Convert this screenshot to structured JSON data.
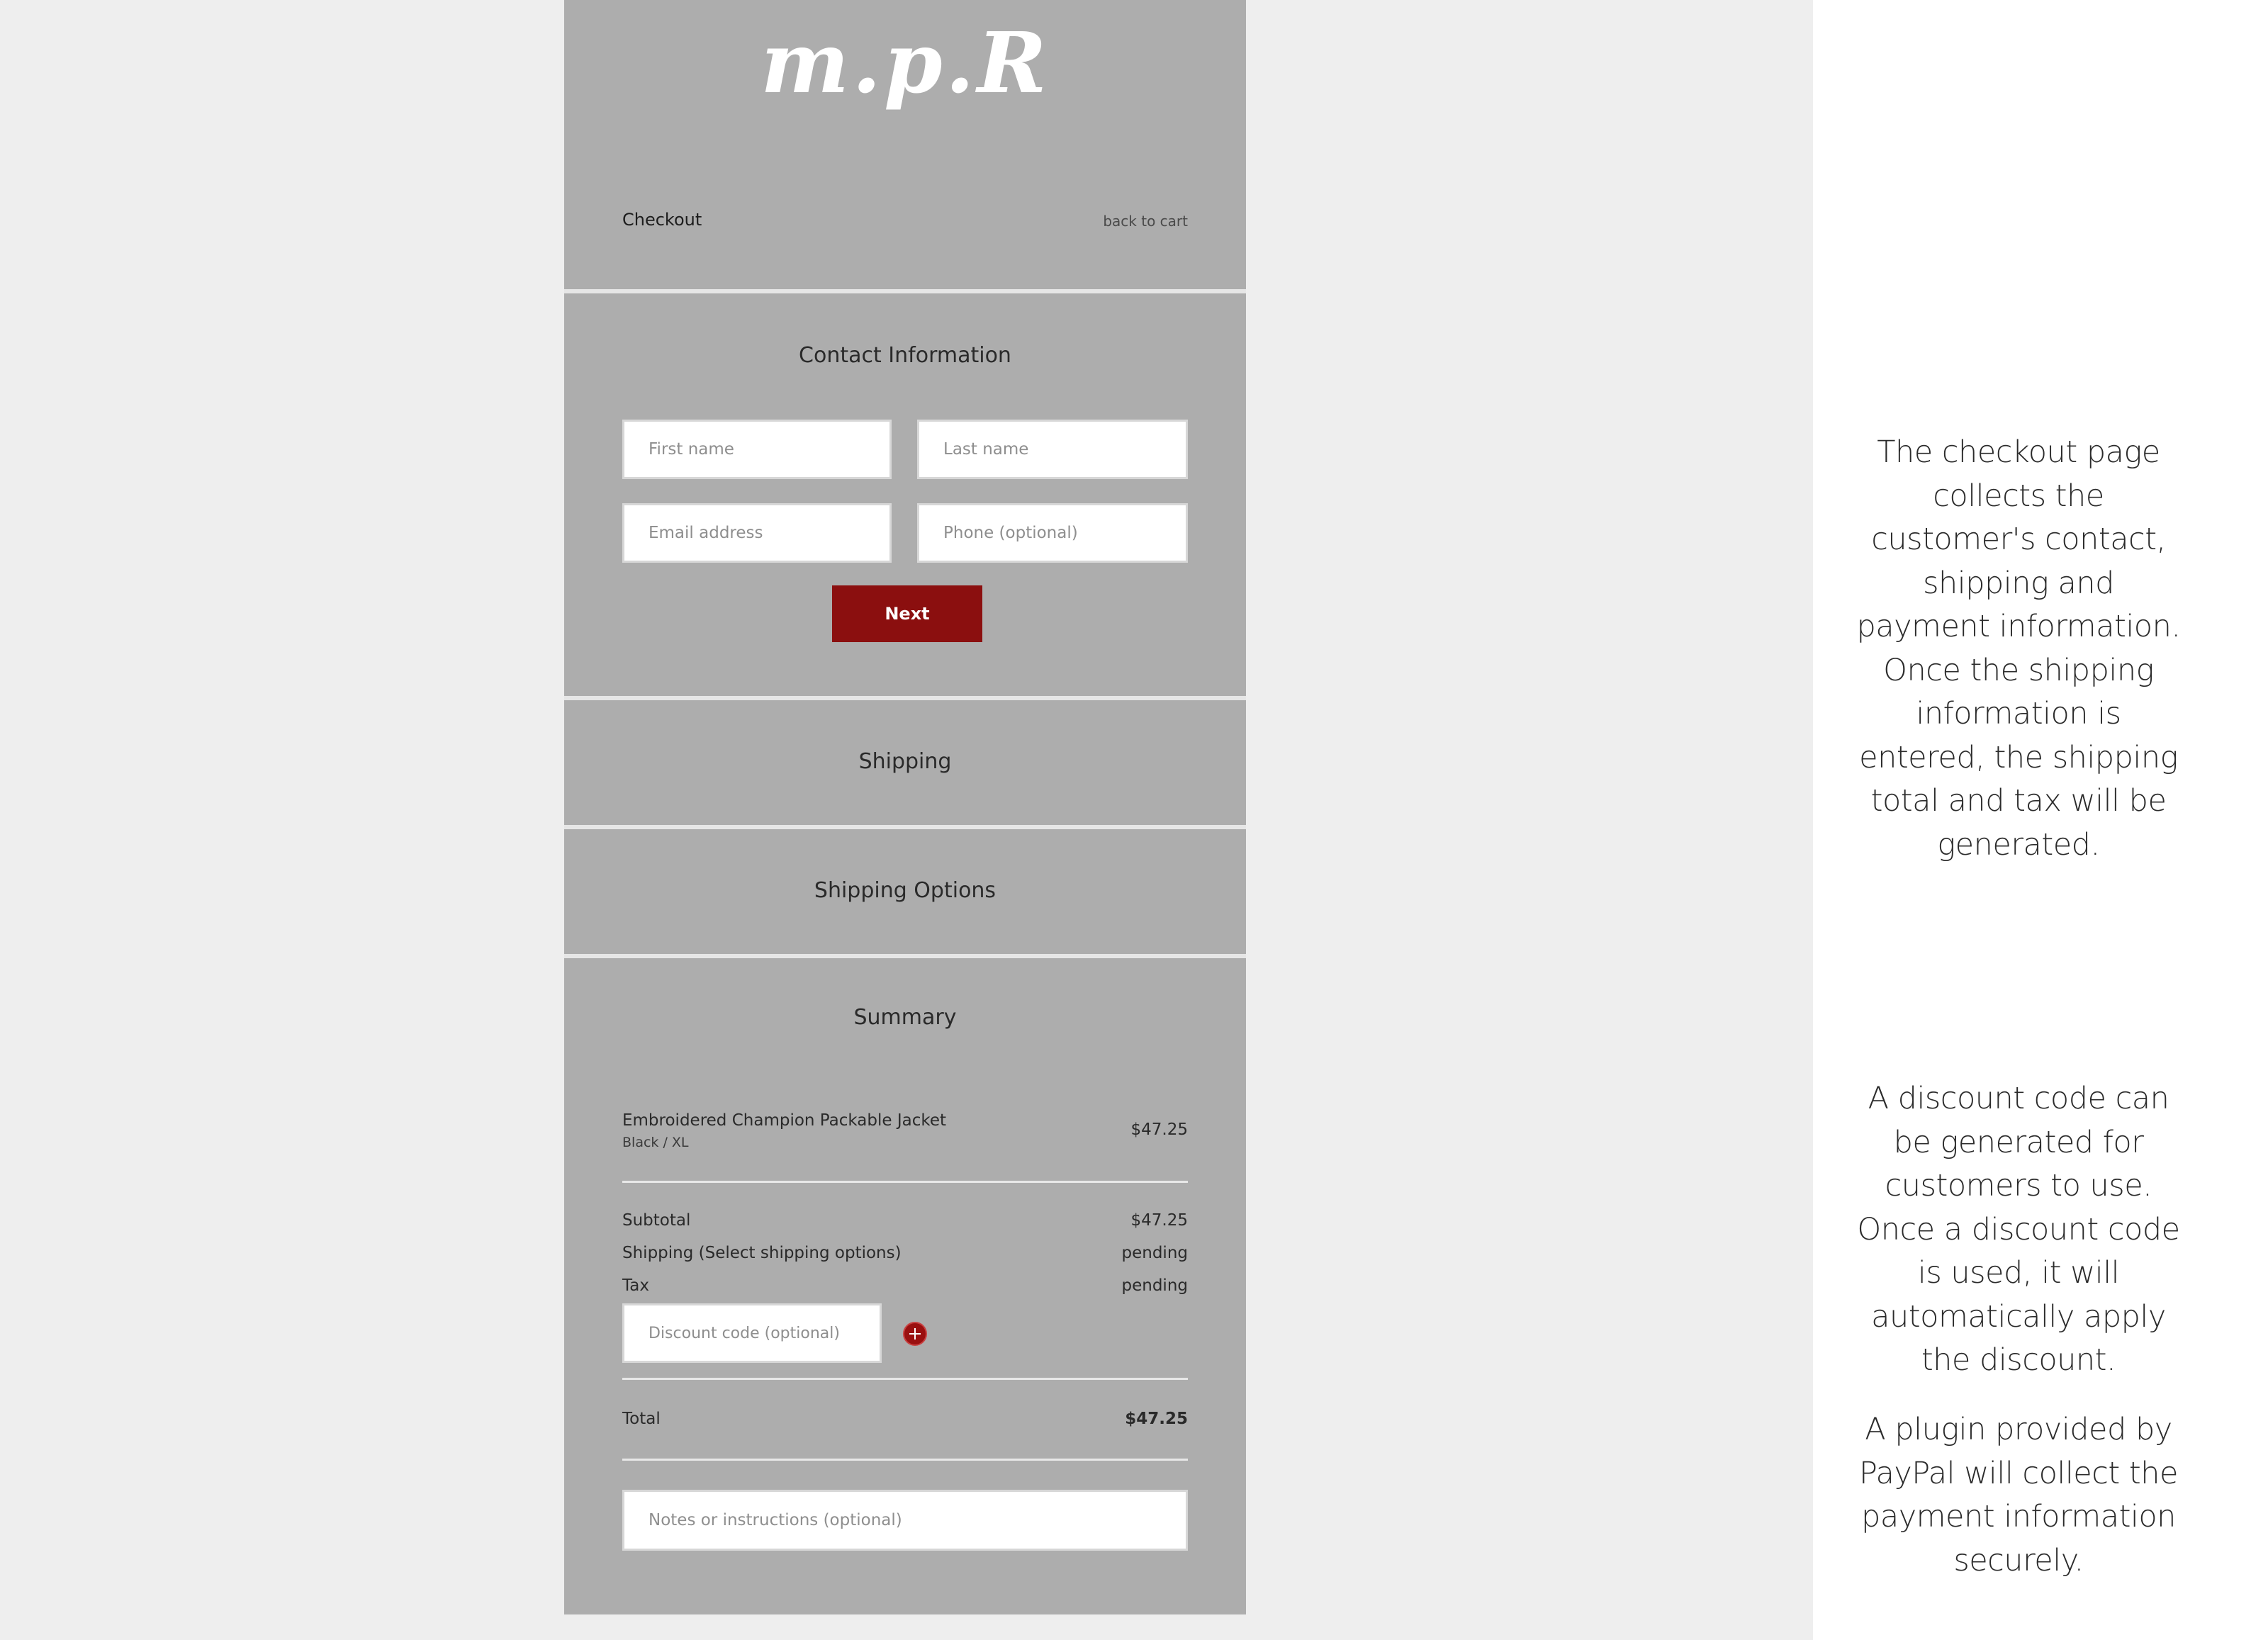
{
  "brand": {
    "logo_text": "m.p.R"
  },
  "header": {
    "title": "Checkout",
    "back_link": "back to cart"
  },
  "contact": {
    "title": "Contact Information",
    "first_name_placeholder": "First name",
    "last_name_placeholder": "Last name",
    "email_placeholder": "Email address",
    "phone_placeholder": "Phone (optional)",
    "next_label": "Next"
  },
  "shipping": {
    "title": "Shipping"
  },
  "shipping_options": {
    "title": "Shipping Options"
  },
  "summary": {
    "title": "Summary",
    "item": {
      "name": "Embroidered Champion Packable Jacket",
      "variant": "Black / XL",
      "price": "$47.25"
    },
    "subtotal_label": "Subtotal",
    "subtotal_value": "$47.25",
    "shipping_label": "Shipping (Select shipping options)",
    "shipping_value": "pending",
    "tax_label": "Tax",
    "tax_value": "pending",
    "discount_placeholder": "Discount code (optional)",
    "total_label": "Total",
    "total_value": "$47.25",
    "notes_placeholder": "Notes or instructions (optional)"
  },
  "annotations": {
    "checkout_note": "The checkout page collects the customer's contact, shipping and payment information. Once the shipping information is entered, the shipping total and tax will be generated.",
    "discount_note": "A discount code can be generated for customers to use. Once a discount code is used, it will automatically apply the discount.",
    "paypal_note": "A plugin provided by PayPal will collect the payment information securely."
  },
  "colors": {
    "panel": "#adadad",
    "accent": "#8b0f0f",
    "background": "#eeeeee"
  },
  "icons": {
    "add_discount": "plus-circle-icon"
  }
}
